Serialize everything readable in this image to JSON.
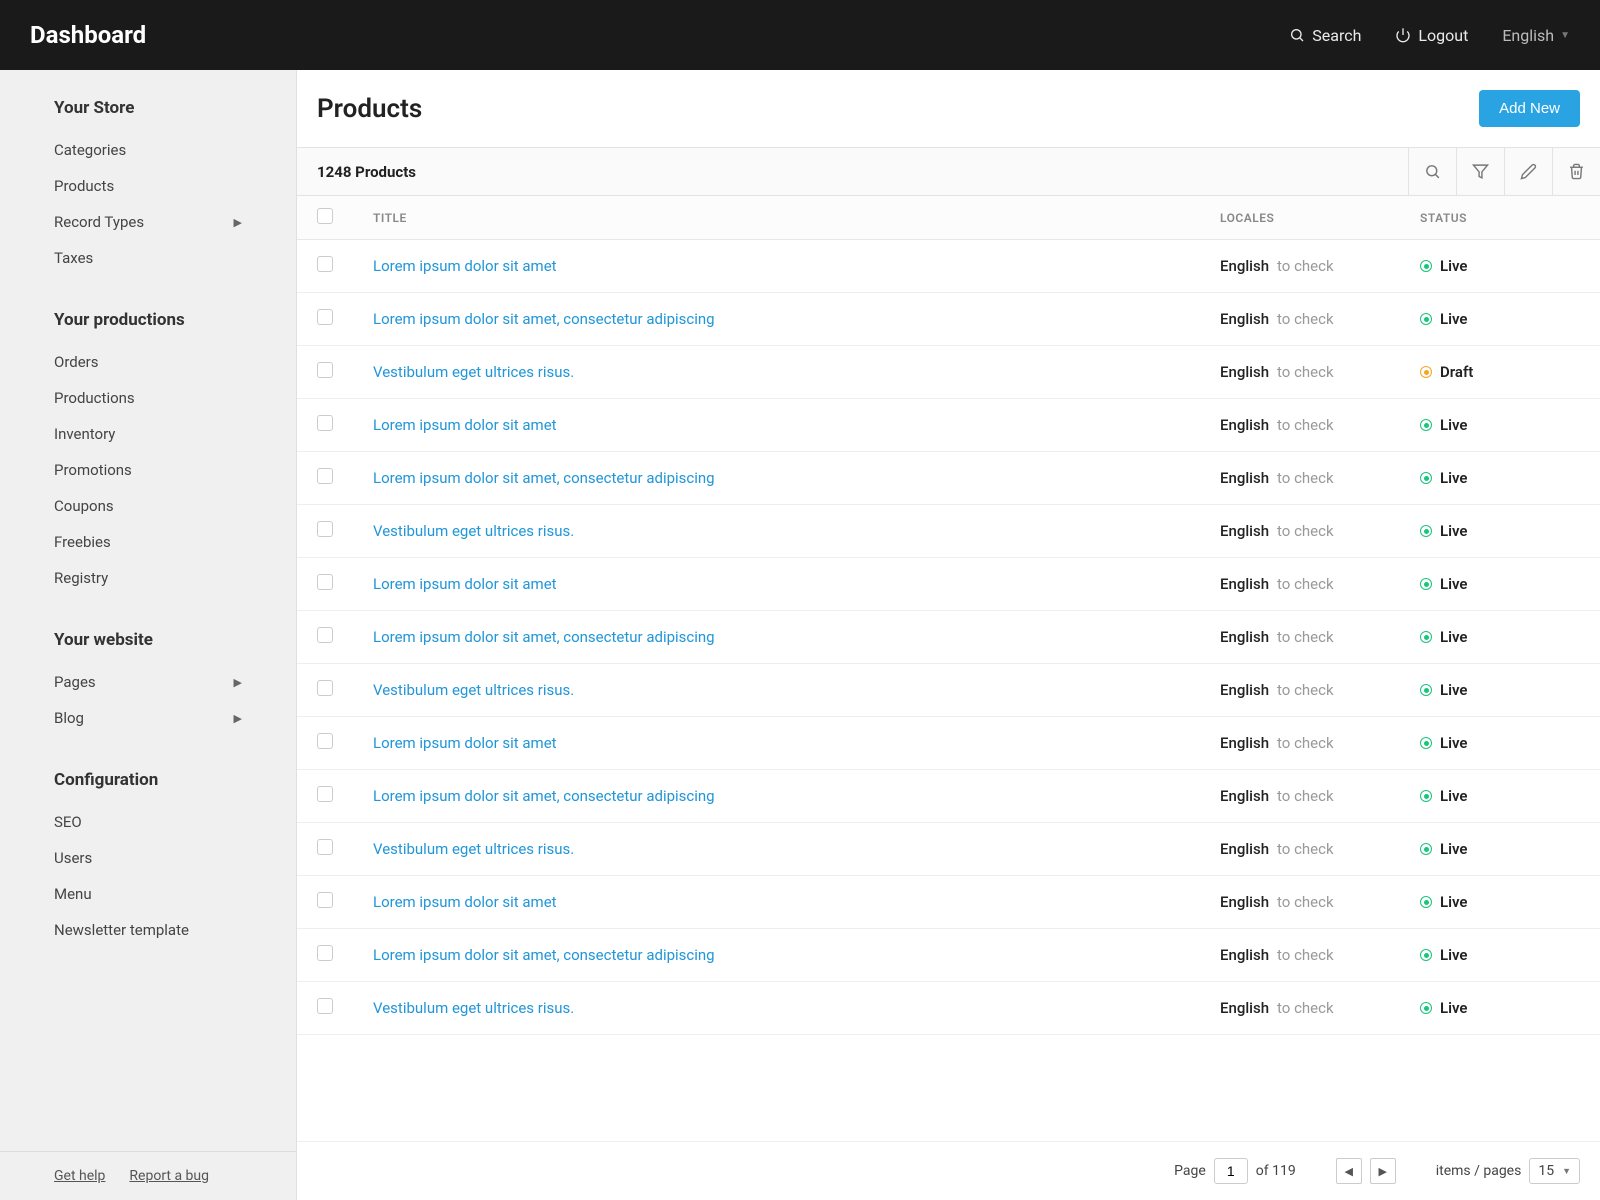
{
  "topbar": {
    "title": "Dashboard",
    "search": "Search",
    "logout": "Logout",
    "language": "English"
  },
  "sidebar": {
    "sections": [
      {
        "heading": "Your Store",
        "items": [
          {
            "label": "Categories",
            "expandable": false
          },
          {
            "label": "Products",
            "expandable": false
          },
          {
            "label": "Record Types",
            "expandable": true
          },
          {
            "label": "Taxes",
            "expandable": false
          }
        ]
      },
      {
        "heading": "Your productions",
        "items": [
          {
            "label": "Orders",
            "expandable": false
          },
          {
            "label": "Productions",
            "expandable": false
          },
          {
            "label": "Inventory",
            "expandable": false
          },
          {
            "label": "Promotions",
            "expandable": false
          },
          {
            "label": "Coupons",
            "expandable": false
          },
          {
            "label": "Freebies",
            "expandable": false
          },
          {
            "label": "Registry",
            "expandable": false
          }
        ]
      },
      {
        "heading": "Your website",
        "items": [
          {
            "label": "Pages",
            "expandable": true
          },
          {
            "label": "Blog",
            "expandable": true
          }
        ]
      },
      {
        "heading": "Configuration",
        "items": [
          {
            "label": "SEO",
            "expandable": false
          },
          {
            "label": "Users",
            "expandable": false
          },
          {
            "label": "Menu",
            "expandable": false
          },
          {
            "label": "Newsletter template",
            "expandable": false
          }
        ]
      }
    ],
    "footer": {
      "get_help": "Get help",
      "report_bug": "Report a bug"
    }
  },
  "main": {
    "page_title": "Products",
    "add_new": "Add New",
    "count_label": "1248 Products",
    "columns": {
      "title": "TITLE",
      "locales": "LOCALES",
      "status": "STATUS"
    },
    "rows": [
      {
        "title": "Lorem ipsum dolor sit amet",
        "locale_primary": "English",
        "locale_secondary": "to check",
        "status": "Live",
        "status_kind": "live"
      },
      {
        "title": "Lorem ipsum dolor sit amet, consectetur adipiscing",
        "locale_primary": "English",
        "locale_secondary": "to check",
        "status": "Live",
        "status_kind": "live"
      },
      {
        "title": "Vestibulum eget ultrices risus.",
        "locale_primary": "English",
        "locale_secondary": "to check",
        "status": "Draft",
        "status_kind": "draft"
      },
      {
        "title": "Lorem ipsum dolor sit amet",
        "locale_primary": "English",
        "locale_secondary": "to check",
        "status": "Live",
        "status_kind": "live"
      },
      {
        "title": "Lorem ipsum dolor sit amet, consectetur adipiscing",
        "locale_primary": "English",
        "locale_secondary": "to check",
        "status": "Live",
        "status_kind": "live"
      },
      {
        "title": "Vestibulum eget ultrices risus.",
        "locale_primary": "English",
        "locale_secondary": "to check",
        "status": "Live",
        "status_kind": "live"
      },
      {
        "title": "Lorem ipsum dolor sit amet",
        "locale_primary": "English",
        "locale_secondary": "to check",
        "status": "Live",
        "status_kind": "live"
      },
      {
        "title": "Lorem ipsum dolor sit amet, consectetur adipiscing",
        "locale_primary": "English",
        "locale_secondary": "to check",
        "status": "Live",
        "status_kind": "live"
      },
      {
        "title": "Vestibulum eget ultrices risus.",
        "locale_primary": "English",
        "locale_secondary": "to check",
        "status": "Live",
        "status_kind": "live"
      },
      {
        "title": "Lorem ipsum dolor sit amet",
        "locale_primary": "English",
        "locale_secondary": "to check",
        "status": "Live",
        "status_kind": "live"
      },
      {
        "title": "Lorem ipsum dolor sit amet, consectetur adipiscing",
        "locale_primary": "English",
        "locale_secondary": "to check",
        "status": "Live",
        "status_kind": "live"
      },
      {
        "title": "Vestibulum eget ultrices risus.",
        "locale_primary": "English",
        "locale_secondary": "to check",
        "status": "Live",
        "status_kind": "live"
      },
      {
        "title": "Lorem ipsum dolor sit amet",
        "locale_primary": "English",
        "locale_secondary": "to check",
        "status": "Live",
        "status_kind": "live"
      },
      {
        "title": "Lorem ipsum dolor sit amet, consectetur adipiscing",
        "locale_primary": "English",
        "locale_secondary": "to check",
        "status": "Live",
        "status_kind": "live"
      },
      {
        "title": "Vestibulum eget ultrices risus.",
        "locale_primary": "English",
        "locale_secondary": "to check",
        "status": "Live",
        "status_kind": "live"
      }
    ],
    "pagination": {
      "page_label": "Page",
      "page_value": "1",
      "of_label": "of 119",
      "items_label": "items / pages",
      "items_value": "15"
    }
  }
}
